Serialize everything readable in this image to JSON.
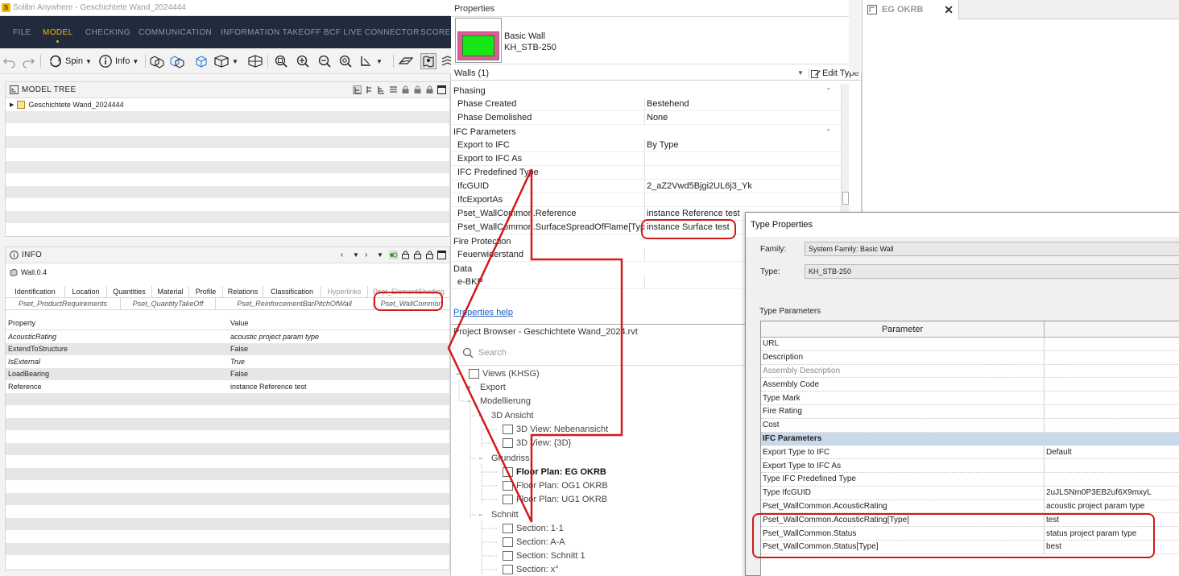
{
  "solibri": {
    "window_title": "Solibri Anywhere - Geschichtete Wand_2024444",
    "menu": [
      {
        "label": "FILE",
        "active": false
      },
      {
        "label": "MODEL",
        "active": true
      },
      {
        "label": "CHECKING",
        "active": false
      },
      {
        "label": "COMMUNICATION",
        "active": false
      },
      {
        "label": "INFORMATION TAKEOFF",
        "active": false
      },
      {
        "label": "BCF LIVE CONNECTOR",
        "active": false
      },
      {
        "label": "SCORE",
        "active": false
      }
    ],
    "toolbar": {
      "spin_label": "Spin",
      "info_label": "Info"
    },
    "model_tree": {
      "title": "MODEL TREE",
      "root_item": "Geschichtete Wand_2024444"
    },
    "info": {
      "title": "INFO",
      "component": "Wall.0.4",
      "tabs_row1": [
        "Identification",
        "Location",
        "Quantities",
        "Material",
        "Profile",
        "Relations",
        "Classification",
        "Hyperlinks",
        "Pset_ElementShading"
      ],
      "tabs_row2": [
        "Pset_ProductRequirements",
        "Pset_QuantityTakeOff",
        "Pset_ReinforcementBarPitchOfWall",
        "Pset_WallCommon"
      ],
      "headers": {
        "property": "Property",
        "value": "Value"
      },
      "rows": [
        {
          "property": "AcousticRating",
          "value": "acoustic project param type",
          "italic": true
        },
        {
          "property": "ExtendToStructure",
          "value": "False",
          "italic": false
        },
        {
          "property": "IsExternal",
          "value": "True",
          "italic": true
        },
        {
          "property": "LoadBearing",
          "value": "False",
          "italic": false
        },
        {
          "property": "Reference",
          "value": "instance Reference test",
          "italic": false
        }
      ]
    }
  },
  "revit_properties": {
    "title": "Properties",
    "family": "Basic Wall",
    "type": "KH_STB-250",
    "selector": "Walls (1)",
    "edit_type_label": "Edit Type",
    "groups": [
      {
        "name": "Phasing",
        "rows": [
          {
            "param": "Phase Created",
            "value": "Bestehend"
          },
          {
            "param": "Phase Demolished",
            "value": "None"
          }
        ]
      },
      {
        "name": "IFC Parameters",
        "rows": [
          {
            "param": "Export to IFC",
            "value": "By Type"
          },
          {
            "param": "Export to IFC As",
            "value": ""
          },
          {
            "param": "IFC Predefined Type",
            "value": ""
          },
          {
            "param": "IfcGUID",
            "value": "2_aZ2Vwd5Bjgi2UL6j3_Yk"
          },
          {
            "param": "IfcExportAs",
            "value": ""
          },
          {
            "param": "Pset_WallCommon.Reference",
            "value": "instance Reference test"
          },
          {
            "param": "Pset_WallCommon.SurfaceSpreadOfFlame[Type]",
            "value": "instance Surface test"
          }
        ]
      },
      {
        "name": "Fire Protection",
        "rows": [
          {
            "param": "Feuerwiderstand",
            "value": ""
          }
        ]
      },
      {
        "name": "Data",
        "rows": [
          {
            "param": "e-BKP",
            "value": ""
          }
        ]
      }
    ],
    "help_link": "Properties help"
  },
  "project_browser": {
    "title": "Project Browser - Geschichtete Wand_2024.rvt",
    "search_placeholder": "Search",
    "items": [
      {
        "label": "Views (KHSG)",
        "toggle": "−",
        "bold": false,
        "icon": true
      },
      {
        "label": "Export",
        "toggle": "+",
        "bold": false,
        "icon": false
      },
      {
        "label": "Modellierung",
        "toggle": "−",
        "bold": false,
        "icon": false
      },
      {
        "label": "3D Ansicht",
        "toggle": "−",
        "bold": false,
        "icon": false
      },
      {
        "label": "3D View: Nebenansicht",
        "toggle": "",
        "bold": false,
        "icon": true
      },
      {
        "label": "3D View: {3D}",
        "toggle": "",
        "bold": false,
        "icon": true
      },
      {
        "label": "Grundriss",
        "toggle": "−",
        "bold": false,
        "icon": false
      },
      {
        "label": "Floor Plan: EG OKRB",
        "toggle": "",
        "bold": true,
        "icon": true
      },
      {
        "label": "Floor Plan: OG1 OKRB",
        "toggle": "",
        "bold": false,
        "icon": true
      },
      {
        "label": "Floor Plan: UG1 OKRB",
        "toggle": "",
        "bold": false,
        "icon": true
      },
      {
        "label": "Schnitt",
        "toggle": "−",
        "bold": false,
        "icon": false
      },
      {
        "label": "Section: 1-1",
        "toggle": "",
        "bold": false,
        "icon": true
      },
      {
        "label": "Section: A-A",
        "toggle": "",
        "bold": false,
        "icon": true
      },
      {
        "label": "Section: Schnitt 1",
        "toggle": "",
        "bold": false,
        "icon": true
      },
      {
        "label": "Section: x°",
        "toggle": "",
        "bold": false,
        "icon": true
      }
    ]
  },
  "view_tab": {
    "label": "EG OKRB"
  },
  "type_properties": {
    "title": "Type Properties",
    "family_label": "Family:",
    "family_value": "System Family: Basic Wall",
    "type_label": "Type:",
    "type_value": "KH_STB-250",
    "section_label": "Type Parameters",
    "column_header": "Parameter",
    "rows": [
      {
        "param": "URL",
        "value": "",
        "style": ""
      },
      {
        "param": "Description",
        "value": "",
        "style": ""
      },
      {
        "param": "Assembly Description",
        "value": "",
        "style": "grey"
      },
      {
        "param": "Assembly Code",
        "value": "",
        "style": ""
      },
      {
        "param": "Type Mark",
        "value": "",
        "style": ""
      },
      {
        "param": "Fire Rating",
        "value": "",
        "style": ""
      },
      {
        "param": "Cost",
        "value": "",
        "style": ""
      },
      {
        "param": "IFC Parameters",
        "value": "",
        "style": "group"
      },
      {
        "param": "Export Type to IFC",
        "value": "Default",
        "style": ""
      },
      {
        "param": "Export Type to IFC As",
        "value": "",
        "style": ""
      },
      {
        "param": "Type IFC Predefined Type",
        "value": "",
        "style": ""
      },
      {
        "param": "Type IfcGUID",
        "value": "2uJLSNm0P3EB2uf6X9mxyL",
        "style": ""
      },
      {
        "param": "Pset_WallCommon.AcousticRating",
        "value": "acoustic project param type",
        "style": ""
      },
      {
        "param": "Pset_WallCommon.AcousticRating[Type]",
        "value": "test",
        "style": ""
      },
      {
        "param": "Pset_WallCommon.Status",
        "value": "status project param type",
        "style": ""
      },
      {
        "param": "Pset_WallCommon.Status[Type]",
        "value": "best",
        "style": ""
      }
    ]
  },
  "colors": {
    "solibri_menu_bg": "#212b3d",
    "solibri_accent": "#f2b705",
    "annotation_red": "#d11a1a",
    "ifc_group_row": "#c7d9eb",
    "swatch_pink": "#e6569b",
    "swatch_green": "#15e614"
  }
}
